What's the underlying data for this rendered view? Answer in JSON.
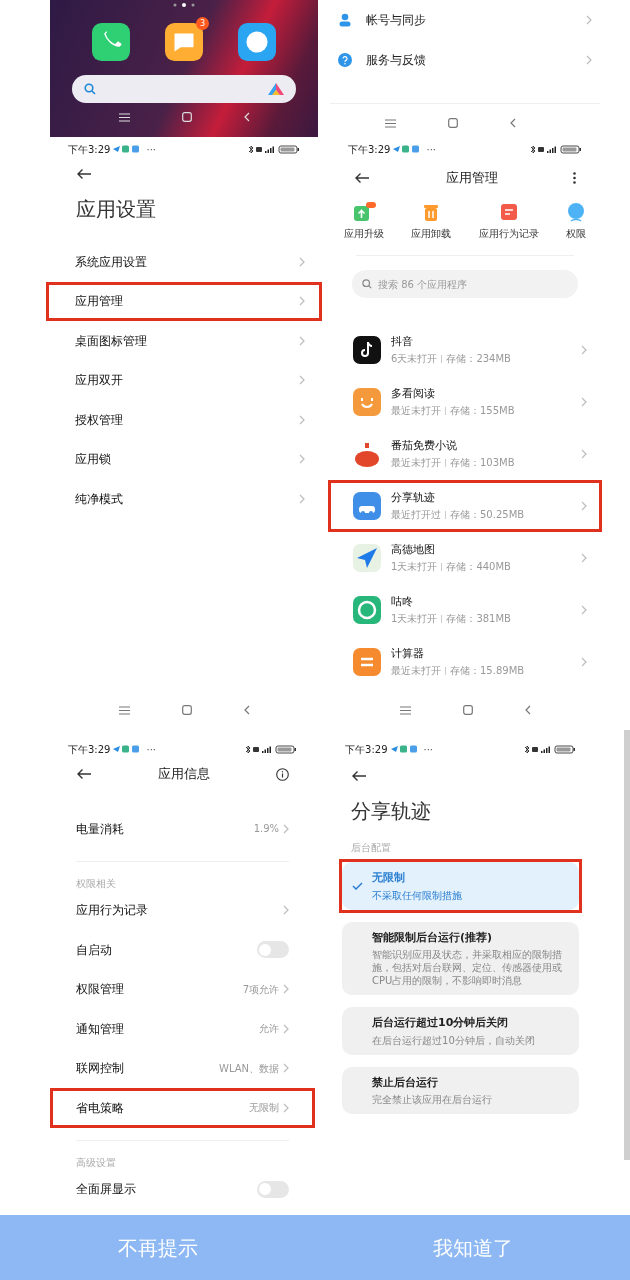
{
  "home_screen": {
    "apps": [
      {
        "kind": "phone"
      },
      {
        "kind": "messages",
        "badge": "3"
      },
      {
        "kind": "browser"
      }
    ]
  },
  "settings_tail": {
    "items": [
      {
        "kind": "account",
        "label": "帐号与同步"
      },
      {
        "kind": "help",
        "label": "服务与反馈"
      }
    ]
  },
  "app_settings": {
    "status_time": "下午3:29",
    "status_more": "···",
    "title": "应用设置",
    "items": [
      {
        "label": "系统应用设置",
        "highlighted": false
      },
      {
        "label": "应用管理",
        "highlighted": true
      },
      {
        "label": "桌面图标管理",
        "highlighted": false
      },
      {
        "label": "应用双开",
        "highlighted": false
      },
      {
        "label": "授权管理",
        "highlighted": false
      },
      {
        "label": "应用锁",
        "highlighted": false
      },
      {
        "label": "纯净模式",
        "highlighted": false
      }
    ]
  },
  "app_management": {
    "status_time": "下午3:29",
    "status_more": "···",
    "title": "应用管理",
    "tools": [
      {
        "kind": "upgrade",
        "label": "应用升级"
      },
      {
        "kind": "uninstall",
        "label": "应用卸载"
      },
      {
        "kind": "record",
        "label": "应用行为记录"
      },
      {
        "kind": "permission",
        "label": "权限"
      }
    ],
    "search": {
      "placeholder": "搜索 86 个应用程序"
    },
    "apps": [
      {
        "kind": "douyin",
        "name": "抖音",
        "last_open": "6天未打开",
        "storage": "存储：234MB",
        "highlighted": false
      },
      {
        "kind": "duokan",
        "name": "多看阅读",
        "last_open": "最近未打开",
        "storage": "存储：155MB",
        "highlighted": false
      },
      {
        "kind": "tomato",
        "name": "番茄免费小说",
        "last_open": "最近未打开",
        "storage": "存储：103MB",
        "highlighted": false
      },
      {
        "kind": "track",
        "name": "分享轨迹",
        "last_open": "最近打开过",
        "storage": "存储：50.25MB",
        "highlighted": true
      },
      {
        "kind": "map",
        "name": "高德地图",
        "last_open": "1天未打开",
        "storage": "存储：440MB",
        "highlighted": false
      },
      {
        "kind": "gudong",
        "name": "咕咚",
        "last_open": "1天未打开",
        "storage": "存储：381MB",
        "highlighted": false
      },
      {
        "kind": "calculator",
        "name": "计算器",
        "last_open": "最近未打开",
        "storage": "存储：15.89MB",
        "highlighted": false
      }
    ]
  },
  "app_info": {
    "status_time": "下午3:29",
    "status_more": "···",
    "title": "应用信息",
    "rows": [
      {
        "kind": "link",
        "label": "电量消耗",
        "value": "1.9%",
        "highlighted": false
      },
      {
        "kind": "section",
        "label": "权限相关"
      },
      {
        "kind": "link",
        "label": "应用行为记录",
        "highlighted": false
      },
      {
        "kind": "toggle",
        "label": "自启动",
        "on": false
      },
      {
        "kind": "link",
        "label": "权限管理",
        "value": "7项允许",
        "highlighted": false
      },
      {
        "kind": "link",
        "label": "通知管理",
        "value": "允许",
        "highlighted": false
      },
      {
        "kind": "link",
        "label": "联网控制",
        "value": "WLAN、数据",
        "highlighted": false
      },
      {
        "kind": "link",
        "label": "省电策略",
        "value": "无限制",
        "highlighted": true
      },
      {
        "kind": "section",
        "label": "高级设置"
      },
      {
        "kind": "toggle",
        "label": "全面屏显示",
        "on": false
      }
    ]
  },
  "battery_saver": {
    "status_time": "下午3:29",
    "status_more": "···",
    "title": "分享轨迹",
    "section": "后台配置",
    "options": [
      {
        "title": "无限制",
        "description": "不采取任何限制措施",
        "selected": true,
        "highlighted": true
      },
      {
        "title": "智能限制后台运行(推荐)",
        "description": "智能识别应用及状态，并采取相应的限制措施，包括对后台联网、定位、传感器使用或CPU占用的限制，不影响即时消息",
        "selected": false,
        "highlighted": false
      },
      {
        "title": "后台运行超过10分钟后关闭",
        "description": "在后台运行超过10分钟后，自动关闭",
        "selected": false,
        "highlighted": false
      },
      {
        "title": "禁止后台运行",
        "description": "完全禁止该应用在后台运行",
        "selected": false,
        "highlighted": false
      }
    ]
  },
  "footer": {
    "buttons": [
      "不再提示",
      "我知道了"
    ]
  }
}
